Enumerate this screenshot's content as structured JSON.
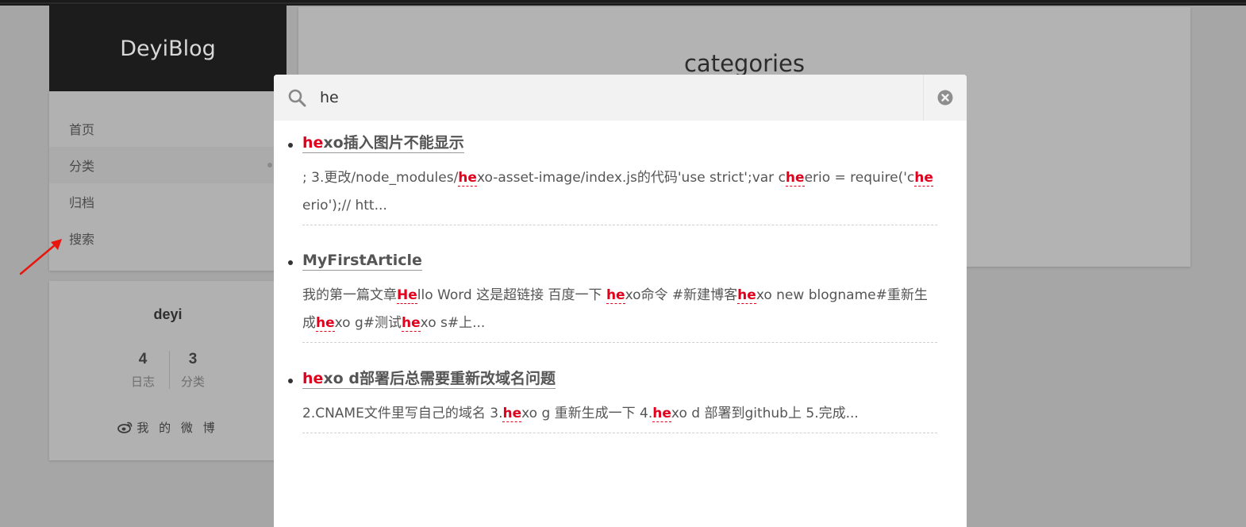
{
  "brand": {
    "title": "DeyiBlog"
  },
  "nav": {
    "items": [
      {
        "label": "首页"
      },
      {
        "label": "分类"
      },
      {
        "label": "归档"
      },
      {
        "label": "搜索"
      }
    ]
  },
  "profile": {
    "author": "deyi",
    "stats": [
      {
        "count": "4",
        "label": "日志"
      },
      {
        "count": "3",
        "label": "分类"
      }
    ],
    "weibo_label": "我 的 微 博"
  },
  "main": {
    "page_title": "categories"
  },
  "search": {
    "query": "he",
    "results": [
      {
        "title_parts": [
          {
            "text": "he",
            "hl": true
          },
          {
            "text": "xo插入图片不能显示",
            "hl": false
          }
        ],
        "excerpt_parts": [
          {
            "text": "; 3.更改/node_modules/",
            "hl": false
          },
          {
            "text": "he",
            "hl": true
          },
          {
            "text": "xo-asset-image/index.js的代码'use strict';var c",
            "hl": false
          },
          {
            "text": "he",
            "hl": true
          },
          {
            "text": "erio = require('c",
            "hl": false
          },
          {
            "text": "he",
            "hl": true
          },
          {
            "text": "erio');// htt...",
            "hl": false
          }
        ]
      },
      {
        "title_parts": [
          {
            "text": "MyFirstArticle",
            "hl": false
          }
        ],
        "excerpt_parts": [
          {
            "text": "我的第一篇文章",
            "hl": false
          },
          {
            "text": "He",
            "hl": true
          },
          {
            "text": "llo Word 这是超链接  百度一下 ",
            "hl": false
          },
          {
            "text": "he",
            "hl": true
          },
          {
            "text": "xo命令 #新建博客",
            "hl": false
          },
          {
            "text": "he",
            "hl": true
          },
          {
            "text": "xo new blogname#重新生成",
            "hl": false
          },
          {
            "text": "he",
            "hl": true
          },
          {
            "text": "xo g#测试",
            "hl": false
          },
          {
            "text": "he",
            "hl": true
          },
          {
            "text": "xo s#上...",
            "hl": false
          }
        ]
      },
      {
        "title_parts": [
          {
            "text": "he",
            "hl": true
          },
          {
            "text": "xo d部署后总需要重新改域名问题",
            "hl": false
          }
        ],
        "excerpt_parts": [
          {
            "text": "2.CNAME文件里写自己的域名 3.",
            "hl": false
          },
          {
            "text": "he",
            "hl": true
          },
          {
            "text": "xo g 重新生成一下    4.",
            "hl": false
          },
          {
            "text": "he",
            "hl": true
          },
          {
            "text": "xo d 部署到github上    5.完成...",
            "hl": false
          }
        ]
      }
    ]
  },
  "colors": {
    "highlight": "#e1001e",
    "arrow": "#e8160c"
  }
}
